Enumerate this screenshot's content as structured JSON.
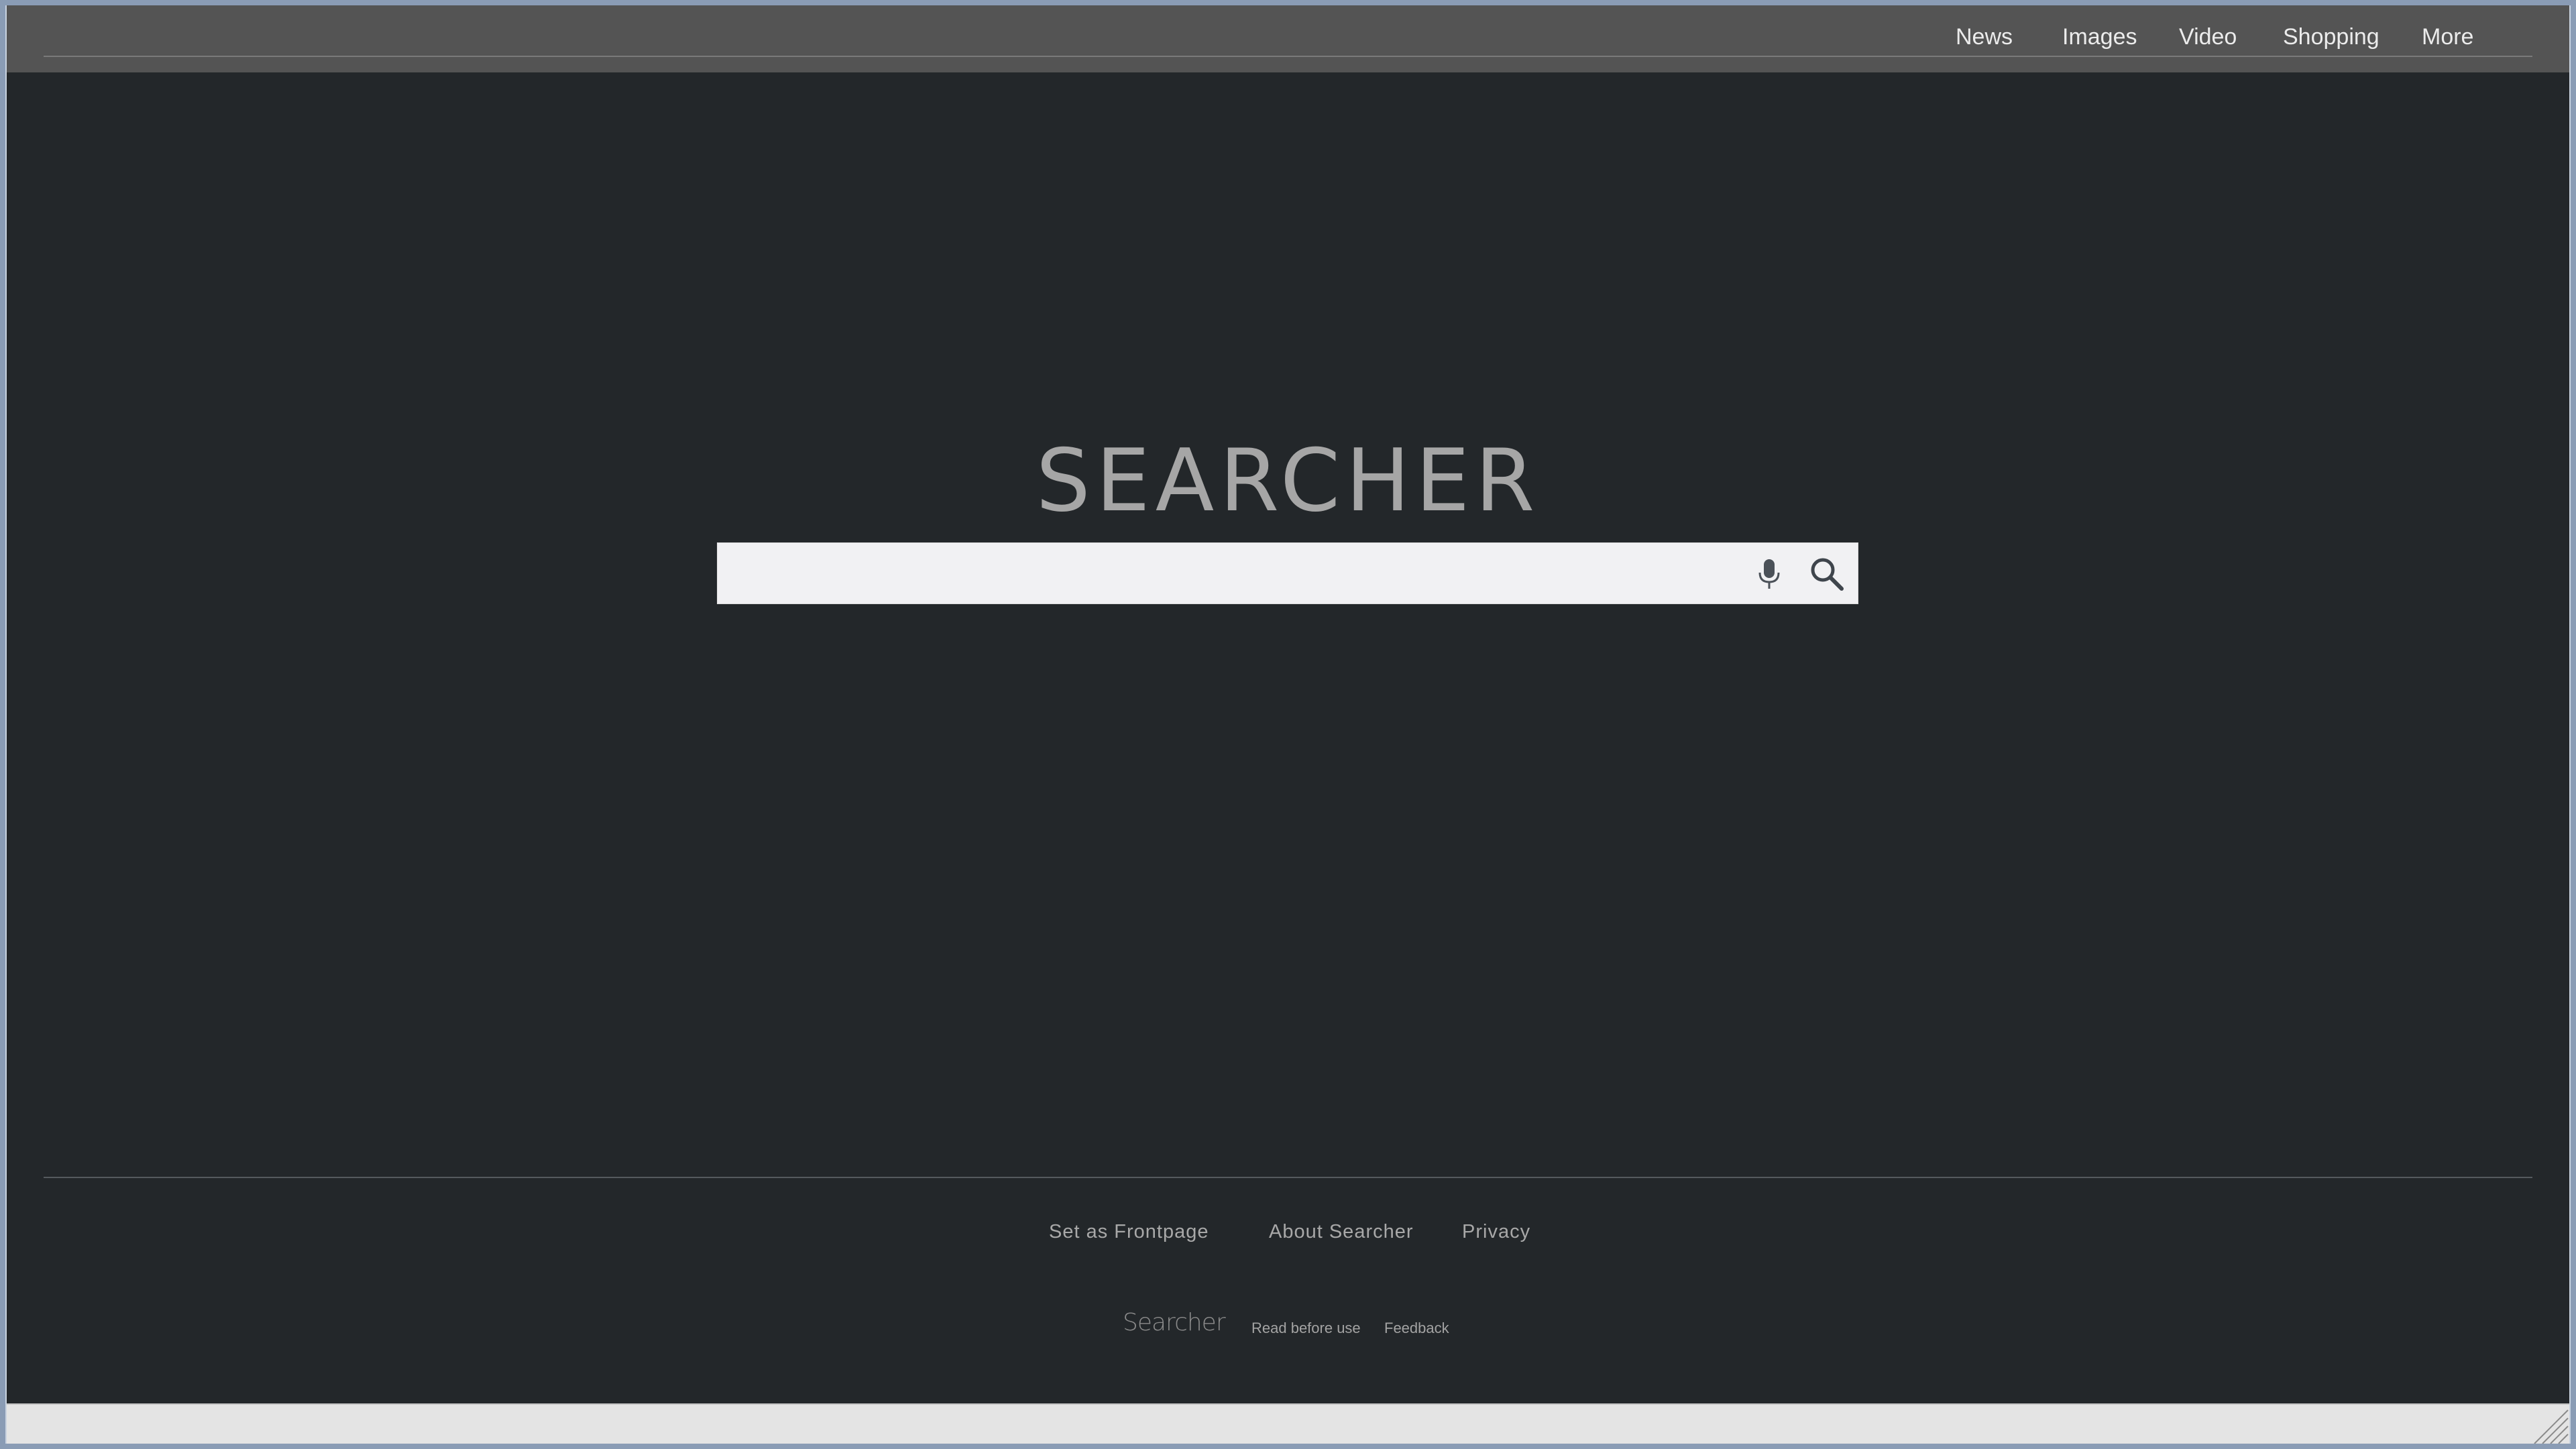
{
  "nav": {
    "items": [
      {
        "label": "News"
      },
      {
        "label": "Images"
      },
      {
        "label": "Video"
      },
      {
        "label": "Shopping"
      },
      {
        "label": "More"
      }
    ]
  },
  "logo": {
    "text": "SEARCHER"
  },
  "search": {
    "value": "",
    "placeholder": ""
  },
  "icons": {
    "mic": "microphone-icon",
    "search": "magnifier-icon"
  },
  "footer": {
    "links": [
      {
        "label": "Set as Frontpage"
      },
      {
        "label": "About Searcher"
      },
      {
        "label": "Privacy"
      }
    ],
    "brand": "Searcher",
    "small_links": [
      {
        "label": "Read before use"
      },
      {
        "label": "Feedback"
      }
    ]
  },
  "colors": {
    "page_background": "#23272a",
    "topbar_background": "#545454",
    "logo_text": "#a6a6a6",
    "search_background": "#f1f1f3"
  }
}
